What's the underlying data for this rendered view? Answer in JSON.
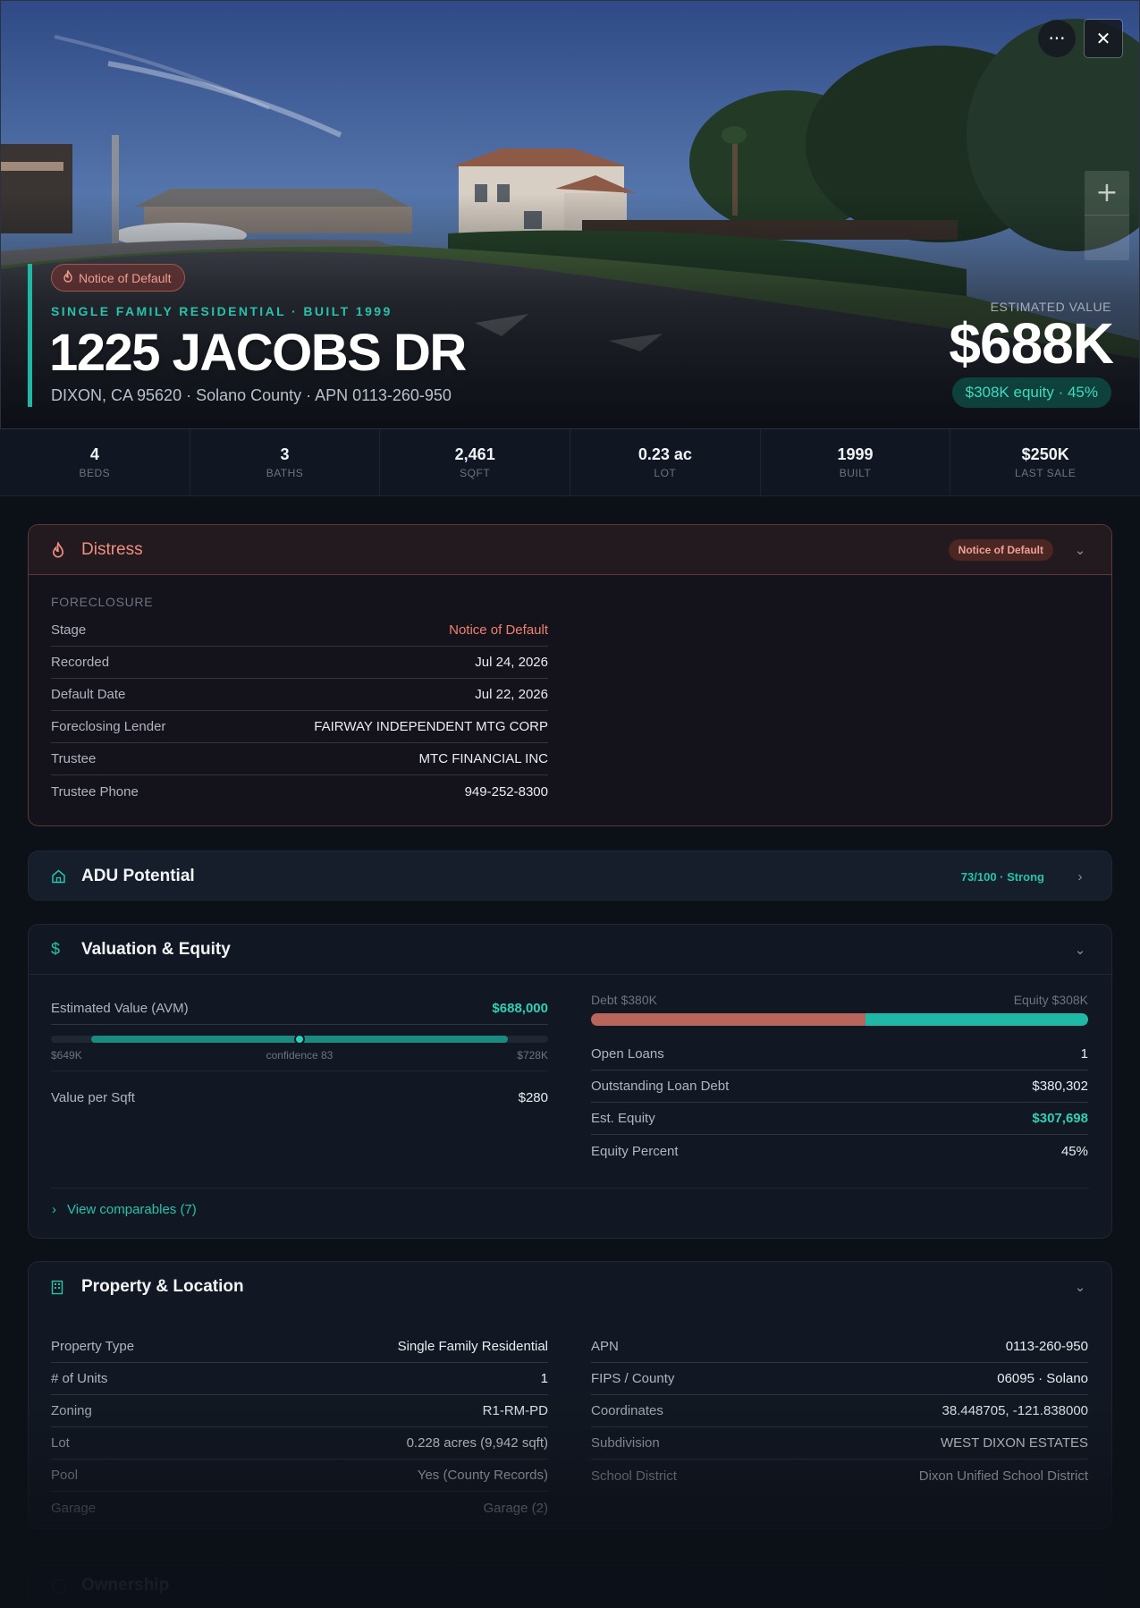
{
  "hero": {
    "badge": "Notice of Default",
    "subtitle": "SINGLE FAMILY RESIDENTIAL · BUILT 1999",
    "title": "1225 JACOBS DR",
    "address": "DIXON, CA 95620 · Solano County · APN 0113-260-950",
    "est_label": "ESTIMATED VALUE",
    "est_value": "$688K",
    "equity_pill": "$308K equity · 45%"
  },
  "stats": [
    {
      "value": "4",
      "label": "BEDS"
    },
    {
      "value": "3",
      "label": "BATHS"
    },
    {
      "value": "2,461",
      "label": "SQFT"
    },
    {
      "value": "0.23 ac",
      "label": "LOT"
    },
    {
      "value": "1999",
      "label": "BUILT"
    },
    {
      "value": "$250K",
      "label": "LAST SALE"
    }
  ],
  "distress": {
    "title": "Distress",
    "badge": "Notice of Default",
    "section": "FORECLOSURE",
    "rows": [
      {
        "k": "Stage",
        "v": "Notice of Default"
      },
      {
        "k": "Recorded",
        "v": "Jul 24, 2026"
      },
      {
        "k": "Default Date",
        "v": "Jul 22, 2026"
      },
      {
        "k": "Foreclosing Lender",
        "v": "FAIRWAY INDEPENDENT MTG CORP"
      },
      {
        "k": "Trustee",
        "v": "MTC FINANCIAL INC"
      },
      {
        "k": "Trustee Phone",
        "v": "949-252-8300"
      }
    ]
  },
  "adu": {
    "title": "ADU Potential",
    "score": "73/100 · Strong"
  },
  "valuation": {
    "title": "Valuation & Equity",
    "avm_label": "Estimated Value (AVM)",
    "avm_value": "$688,000",
    "range_low": "$649K",
    "range_high": "$728K",
    "confidence_label": "confidence 83",
    "confidence_position": 0.5,
    "value_sqft_label": "Value per Sqft",
    "value_sqft": "$280",
    "debt_label": "Debt $380K",
    "equity_label": "Equity $308K",
    "debt_fraction": 0.553,
    "right_rows": [
      {
        "k": "Open Loans",
        "v": "1"
      },
      {
        "k": "Outstanding Loan Debt",
        "v": "$380,302"
      },
      {
        "k": "Est. Equity",
        "v": "$307,698"
      },
      {
        "k": "Equity Percent",
        "v": "45%"
      }
    ],
    "comparables": "View comparables (7)"
  },
  "property": {
    "title": "Property & Location",
    "left_rows": [
      {
        "k": "Property Type",
        "v": "Single Family Residential"
      },
      {
        "k": "# of Units",
        "v": "1"
      },
      {
        "k": "Zoning",
        "v": "R1-RM-PD"
      },
      {
        "k": "Lot",
        "v": "0.228 acres (9,942 sqft)"
      },
      {
        "k": "Pool",
        "v": "Yes (County Records)"
      },
      {
        "k": "Garage",
        "v": "Garage (2)"
      }
    ],
    "right_rows": [
      {
        "k": "APN",
        "v": "0113-260-950"
      },
      {
        "k": "FIPS / County",
        "v": "06095 · Solano"
      },
      {
        "k": "Coordinates",
        "v": "38.448705, -121.838000"
      },
      {
        "k": "Subdivision",
        "v": "WEST DIXON ESTATES"
      },
      {
        "k": "School District",
        "v": "Dixon Unified School District"
      }
    ]
  },
  "ownership": {
    "title": "Ownership"
  },
  "icons": {
    "more": "more-icon",
    "close": "close-icon",
    "zoom": "plus-icon",
    "fire": "fire-icon",
    "home": "home-icon",
    "dollar": "dollar-icon",
    "building": "building-icon"
  },
  "colors": {
    "accent": "#1fb8a6",
    "danger": "#ef8f80",
    "debt": "#b8655b",
    "equity": "#1fb8a6"
  }
}
